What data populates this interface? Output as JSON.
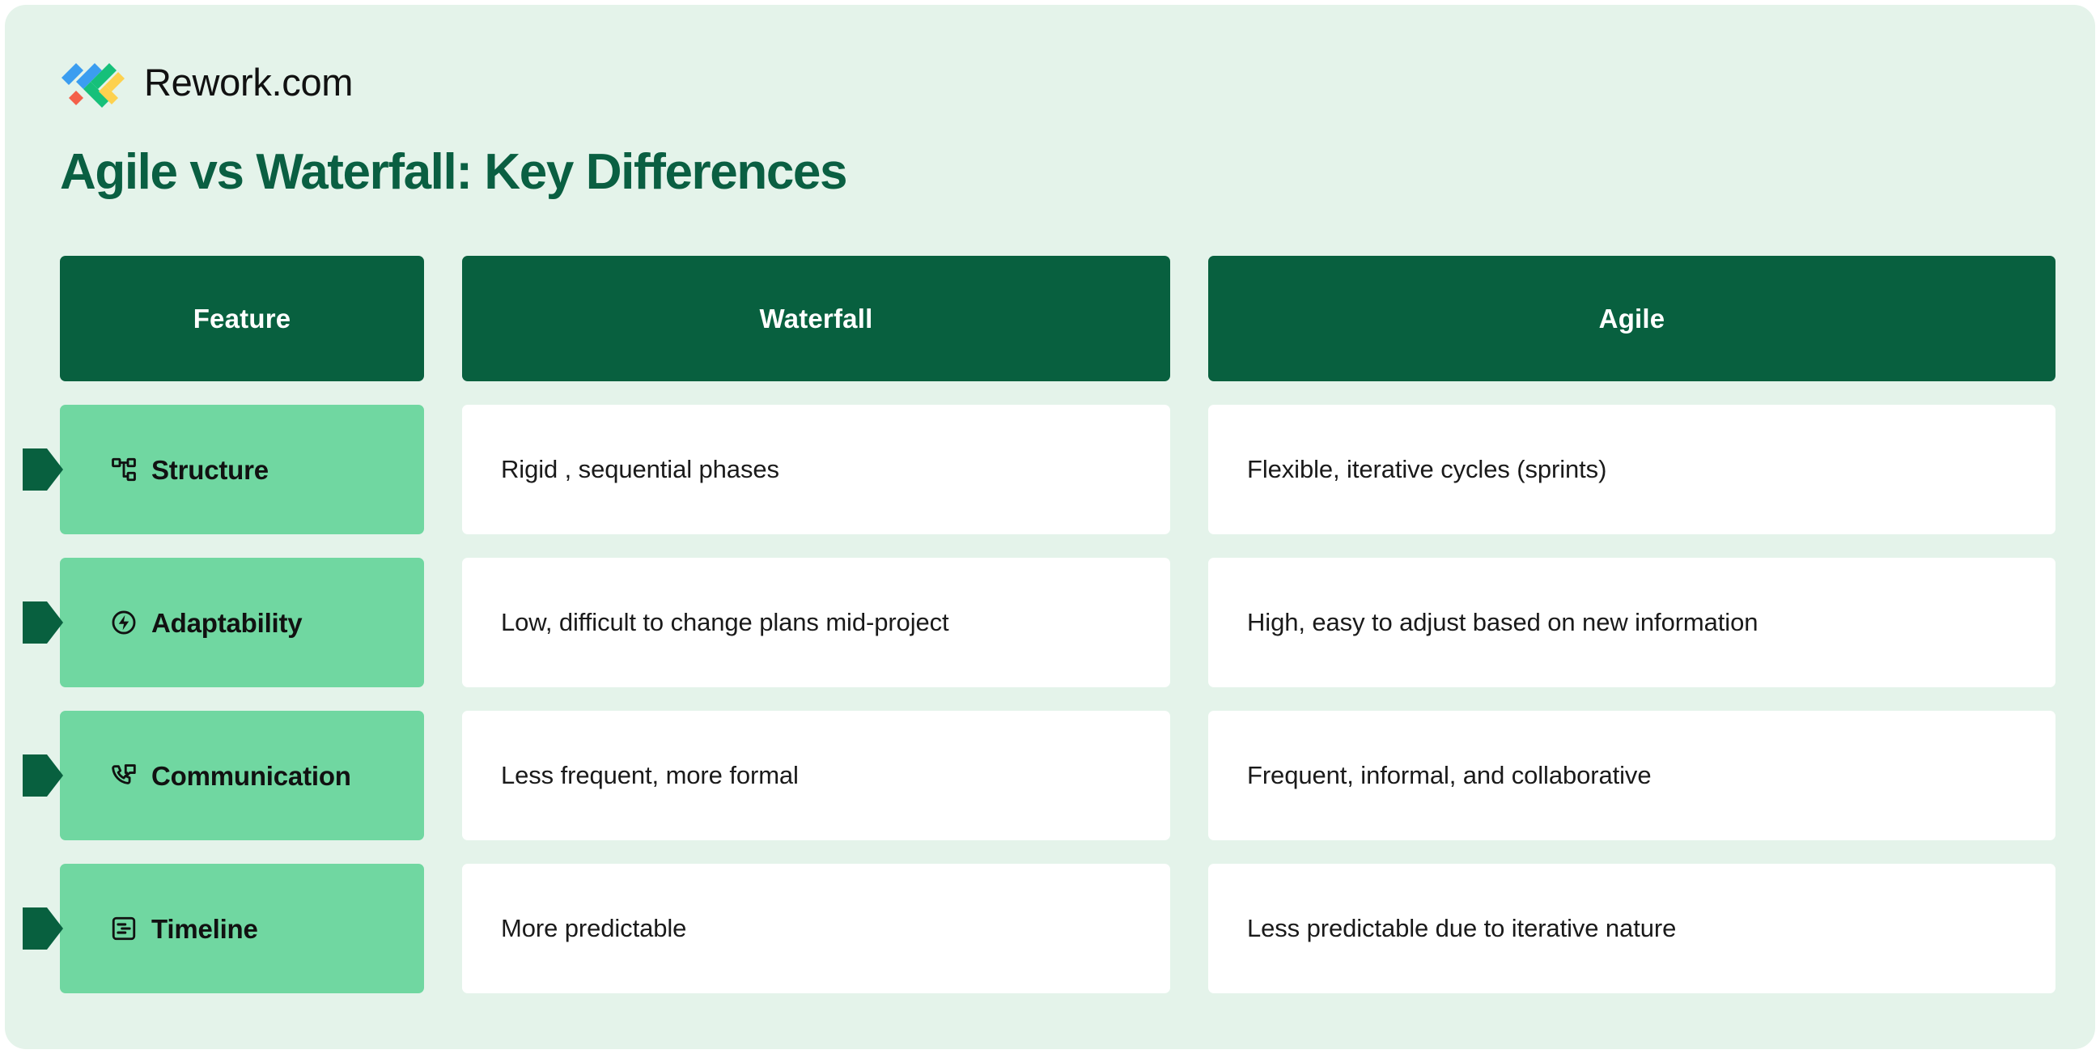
{
  "brand": {
    "name": "Rework.com",
    "logo_icon": "rework-chevrons-logo",
    "logo_colors": [
      "#3B9DF0",
      "#3B9DF0",
      "#16C07A",
      "#FDD14F",
      "#F4604A"
    ]
  },
  "page": {
    "title": "Agile vs Waterfall: Key Differences",
    "background_color": "#E4F3EA",
    "title_color": "#0A5F42",
    "header_color": "#08603F",
    "feature_cell_color": "#70D7A1",
    "value_cell_color": "#FFFFFF"
  },
  "table": {
    "columns": [
      {
        "key": "feature",
        "label": "Feature"
      },
      {
        "key": "waterfall",
        "label": "Waterfall"
      },
      {
        "key": "agile",
        "label": "Agile"
      }
    ],
    "rows": [
      {
        "icon": "sitemap-icon",
        "feature": "Structure",
        "waterfall": "Rigid , sequential phases",
        "agile": "Flexible, iterative cycles (sprints)"
      },
      {
        "icon": "zap-circle-icon",
        "feature": "Adaptability",
        "waterfall": "Low, difficult to change plans mid-project",
        "agile": "High, easy to adjust based on new information"
      },
      {
        "icon": "phone-call-icon",
        "feature": "Communication",
        "waterfall": "Less frequent, more formal",
        "agile": "Frequent, informal, and collaborative"
      },
      {
        "icon": "document-lines-icon",
        "feature": "Timeline",
        "waterfall": "More predictable",
        "agile": "Less predictable due to iterative nature"
      }
    ]
  }
}
